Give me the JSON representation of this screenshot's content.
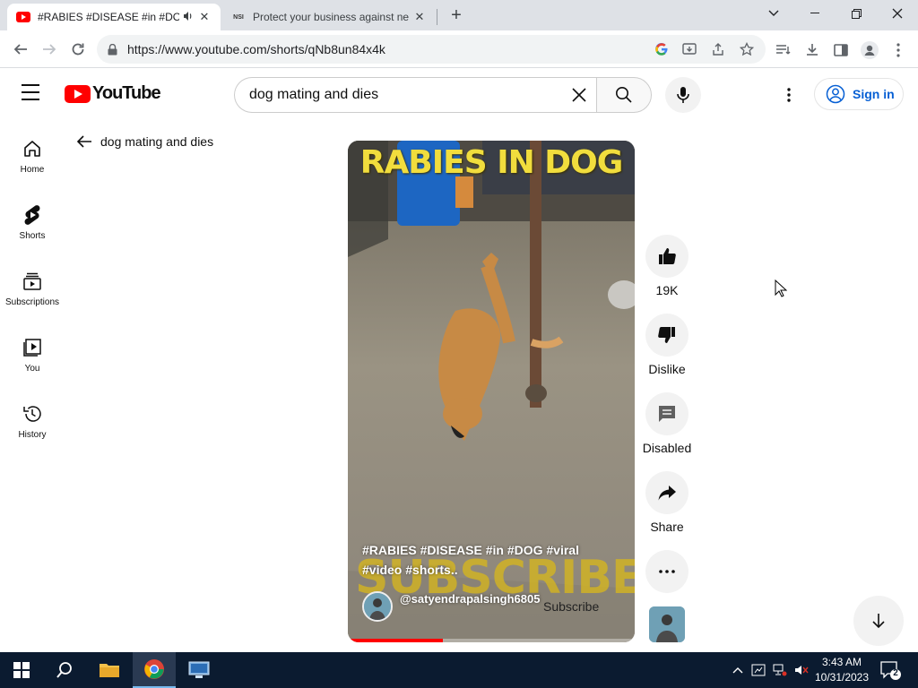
{
  "browser": {
    "tabs": [
      {
        "title": "#RABIES #DISEASE #in #DOG",
        "active": true,
        "favicon": "youtube-icon"
      },
      {
        "title": "Protect your business against ne",
        "active": false,
        "favicon": "nsi-icon"
      }
    ],
    "url": "https://www.youtube.com/shorts/qNb8un84x4k"
  },
  "youtube": {
    "logo_text": "YouTube",
    "search_value": "dog mating and dies",
    "signin_label": "Sign in",
    "guide": [
      {
        "label": "Home",
        "icon": "home-icon"
      },
      {
        "label": "Shorts",
        "icon": "shorts-icon"
      },
      {
        "label": "Subscriptions",
        "icon": "subscriptions-icon"
      },
      {
        "label": "You",
        "icon": "you-icon"
      },
      {
        "label": "History",
        "icon": "history-icon"
      }
    ],
    "back_query": "dog mating and dies"
  },
  "short": {
    "overlay_title": "RABIES IN DOG",
    "watermark": "SUBSCRIBE",
    "caption": "#RABIES #DISEASE #in #DOG #viral #video #shorts..",
    "channel": "@satyendrapalsingh6805",
    "subscribe_label": "Subscribe",
    "progress_fraction": 0.33
  },
  "actions": {
    "like_count": "19K",
    "dislike_label": "Dislike",
    "comments_label": "Disabled",
    "share_label": "Share"
  },
  "taskbar": {
    "time": "3:43 AM",
    "date": "10/31/2023",
    "notification_count": "2"
  },
  "colors": {
    "youtube_red": "#ff0000",
    "link_blue": "#065fd4",
    "overlay_yellow": "#f1dd3d",
    "taskbar": "#0b1b30"
  }
}
